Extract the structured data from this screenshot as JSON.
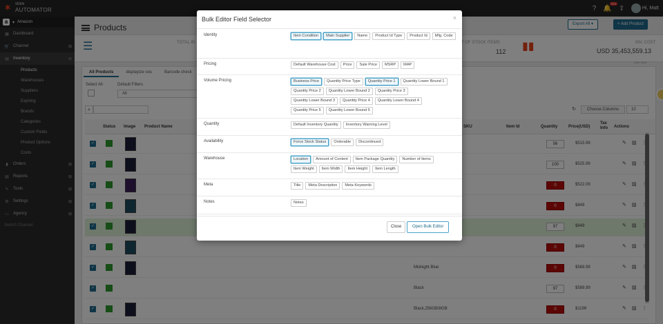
{
  "topbar": {
    "logo_small": "store",
    "logo_big": "AUTOMATOR",
    "notif_count": "374",
    "greeting": "Hi, Matt"
  },
  "sidebar": {
    "account": "Amazon",
    "items": [
      {
        "label": "Dashboard",
        "icon": "dashboard-icon"
      },
      {
        "label": "Channel",
        "icon": "cart-icon"
      },
      {
        "label": "Inventory",
        "icon": "inventory-icon"
      }
    ],
    "inventory_sub": [
      "Products",
      "Warehouses",
      "Suppliers",
      "Expiring",
      "Brands",
      "Categories",
      "Custom Fields",
      "Product Options",
      "Costs"
    ],
    "items_bottom": [
      {
        "label": "Orders",
        "icon": "bar-chart-icon"
      },
      {
        "label": "Reports",
        "icon": "reports-icon"
      },
      {
        "label": "Tools",
        "icon": "wrench-icon"
      },
      {
        "label": "Settings",
        "icon": "gear-icon"
      },
      {
        "label": "Agency",
        "icon": "monitor-icon"
      }
    ],
    "switch_channel": "Switch Channel"
  },
  "header": {
    "title": "Products",
    "export_label": "Export All ▾",
    "add_label": "+ Add Product"
  },
  "stats": {
    "total_label": "TOTAL IN",
    "stock_label": "T OF STOCK ITEMS",
    "stock_value": "112",
    "inv_label": "INV. COST",
    "inv_value": "USD 35,453,559.13",
    "hide_label": "Hide Stats"
  },
  "tabs": [
    "All Products",
    "displayize oos",
    "Barcode check"
  ],
  "filters": {
    "select_all_label": "Select All",
    "default_filters_label": "Default Filters",
    "default_filters_value": "All",
    "choose_columns": "Choose Columns",
    "per_page": "10"
  },
  "table": {
    "headers": {
      "status": "Status",
      "image": "Image",
      "product_name": "Product Name",
      "sku": "SKU",
      "item_id": "Item Id",
      "quantity": "Quantity",
      "price": "Price(USD)",
      "tax": "Tax Info",
      "actions": "Actions"
    },
    "rows": [
      {
        "name": "",
        "qty": "56",
        "zero": false,
        "price": "$515.99",
        "img": "navy",
        "hl": false
      },
      {
        "name": "",
        "qty": "100",
        "zero": false,
        "price": "$525.99",
        "img": "navy",
        "hl": false
      },
      {
        "name": "",
        "qty": "0",
        "zero": true,
        "price": "$522.09",
        "img": "purple",
        "hl": false
      },
      {
        "name": "",
        "qty": "0",
        "zero": true,
        "price": "$849",
        "img": "teal",
        "hl": false
      },
      {
        "name": "",
        "qty": "97",
        "zero": false,
        "price": "$849",
        "img": "navy",
        "hl": true
      },
      {
        "name": "",
        "qty": "0",
        "zero": true,
        "price": "$649",
        "img": "teal",
        "hl": false
      },
      {
        "name": "Midnight Blue",
        "qty": "0",
        "zero": true,
        "price": "$569.99",
        "img": "navy",
        "hl": false
      },
      {
        "name": "Black",
        "qty": "97",
        "zero": false,
        "price": "$589.99",
        "img": "",
        "hl": false
      },
      {
        "name": "Black,256GB/8GB",
        "qty": "0",
        "zero": true,
        "price": "$1199",
        "img": "navy",
        "hl": false
      }
    ]
  },
  "modal": {
    "title": "Bulk Editor Field Selector",
    "sections": [
      {
        "label": "Identity",
        "chips": [
          {
            "text": "Item Condition",
            "sel": true
          },
          {
            "text": "Main Supplier",
            "sel": true
          },
          {
            "text": "Name",
            "sel": false
          },
          {
            "text": "Product Id Type",
            "sel": false
          },
          {
            "text": "Product Id",
            "sel": false
          },
          {
            "text": "Mfg. Code",
            "sel": false
          }
        ]
      },
      {
        "label": "Pricing",
        "chips": [
          {
            "text": "Default Warehouse Cost",
            "sel": false
          },
          {
            "text": "Price",
            "sel": false
          },
          {
            "text": "Sale Price",
            "sel": false
          },
          {
            "text": "MSRP",
            "sel": false
          },
          {
            "text": "MAP",
            "sel": false
          }
        ]
      },
      {
        "label": "Volume Pricing",
        "chips": [
          {
            "text": "Business Price",
            "sel": true
          },
          {
            "text": "Quantity Price Type",
            "sel": false
          },
          {
            "text": "Quantity Price 1",
            "sel": true
          },
          {
            "text": "Quantity Lower Bound 1",
            "sel": false
          },
          {
            "text": "Quantity Price 2",
            "sel": false
          },
          {
            "text": "Quantity Lower Bound 2",
            "sel": false
          },
          {
            "text": "Quantity Price 3",
            "sel": false
          },
          {
            "text": "Quantity Lower Bound 3",
            "sel": false
          },
          {
            "text": "Quantity Price 4",
            "sel": false
          },
          {
            "text": "Quantity Lower Bound 4",
            "sel": false
          },
          {
            "text": "Quantity Price 5",
            "sel": false
          },
          {
            "text": "Quantity Lower Bound 5",
            "sel": false
          }
        ]
      },
      {
        "label": "Quantity",
        "chips": [
          {
            "text": "Default Inventory Quantity",
            "sel": false
          },
          {
            "text": "Inventory Warning Level",
            "sel": false
          }
        ]
      },
      {
        "label": "Availability",
        "chips": [
          {
            "text": "Force Stock Status",
            "sel": true
          },
          {
            "text": "Orderable",
            "sel": false
          },
          {
            "text": "Discontinued",
            "sel": false
          }
        ]
      },
      {
        "label": "Warehouse",
        "chips": [
          {
            "text": "Location",
            "sel": true
          },
          {
            "text": "Amount of Content",
            "sel": false
          },
          {
            "text": "Item Package Quantity",
            "sel": false
          },
          {
            "text": "Number of Items",
            "sel": false
          },
          {
            "text": "Item Weight",
            "sel": false
          },
          {
            "text": "Item Width",
            "sel": false
          },
          {
            "text": "Item Height",
            "sel": false
          },
          {
            "text": "Item Length",
            "sel": false
          }
        ]
      },
      {
        "label": "Meta",
        "chips": [
          {
            "text": "Title",
            "sel": false
          },
          {
            "text": "Meta Description",
            "sel": false
          },
          {
            "text": "Meta Keywords",
            "sel": false
          }
        ]
      },
      {
        "label": "Notes",
        "chips": [
          {
            "text": "Notes",
            "sel": false
          }
        ]
      }
    ],
    "close_label": "Close",
    "open_label": "Open Bulk Editor"
  }
}
